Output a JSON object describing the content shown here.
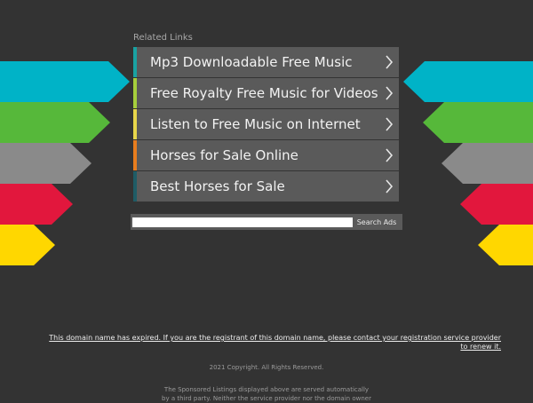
{
  "related_links": {
    "title": "Related Links",
    "items": [
      {
        "label": "Mp3 Downloadable Free Music",
        "color": "#19a2a2"
      },
      {
        "label": "Free Royalty Free Music for Videos",
        "color": "#a6cf3c"
      },
      {
        "label": "Listen to Free Music on Internet",
        "color": "#e8d64a"
      },
      {
        "label": "Horses for Sale Online",
        "color": "#e87d1e"
      },
      {
        "label": "Best Horses for Sale",
        "color": "#1f5c66"
      }
    ]
  },
  "arrows": {
    "colors": [
      "#00b3c7",
      "#56b83a",
      "#8a8a8a",
      "#e2173d",
      "#ffd700"
    ]
  },
  "search": {
    "placeholder": "",
    "button_label": "Search Ads"
  },
  "footer": {
    "expired_line1": "This domain name has expired. If you are the registrant of this domain name, please contact your registration service provider",
    "expired_line2": "to renew it.",
    "copyright": "2021 Copyright. All Rights Reserved.",
    "sponsored_line1": "The Sponsored Listings displayed above are served automatically",
    "sponsored_line2": "by a third party. Neither the service provider nor the domain owner"
  }
}
